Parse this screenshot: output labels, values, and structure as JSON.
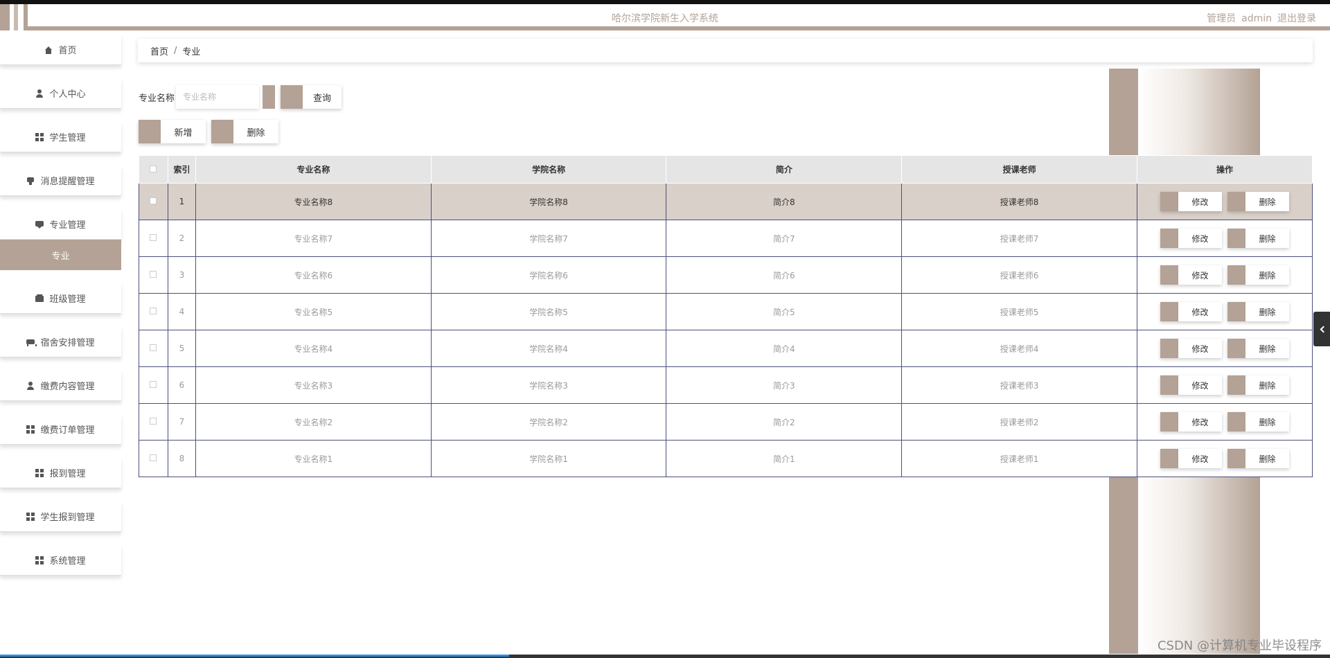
{
  "header": {
    "title": "哈尔滨学院新生入学系统",
    "user_role": "管理员",
    "username": "admin",
    "logout": "退出登录"
  },
  "sidebar": {
    "items": [
      {
        "label": "首页",
        "icon": "home-icon"
      },
      {
        "label": "个人中心",
        "icon": "user-icon"
      },
      {
        "label": "学生管理",
        "icon": "grid-icon"
      },
      {
        "label": "消息提醒管理",
        "icon": "bell-icon"
      },
      {
        "label": "专业管理",
        "icon": "message-icon"
      },
      {
        "label": "班级管理",
        "icon": "wallet-icon"
      },
      {
        "label": "宿舍安排管理",
        "icon": "bed-icon"
      },
      {
        "label": "缴费内容管理",
        "icon": "user-icon"
      },
      {
        "label": "缴费订单管理",
        "icon": "grid-icon"
      },
      {
        "label": "报到管理",
        "icon": "grid-icon"
      },
      {
        "label": "学生报到管理",
        "icon": "grid-icon"
      },
      {
        "label": "系统管理",
        "icon": "grid-icon"
      }
    ],
    "active_sub": "专业"
  },
  "breadcrumb": {
    "home": "首页",
    "sep": "/",
    "current": "专业"
  },
  "search": {
    "label": "专业名称",
    "placeholder": "专业名称",
    "button": "查询"
  },
  "actions": {
    "add": "新增",
    "delete": "删除"
  },
  "table": {
    "headers": [
      "索引",
      "专业名称",
      "学院名称",
      "简介",
      "授课老师",
      "操作"
    ],
    "edit_label": "修改",
    "delete_label": "删除",
    "rows": [
      {
        "index": "1",
        "major": "专业名称8",
        "college": "学院名称8",
        "intro": "简介8",
        "teacher": "授课老师8"
      },
      {
        "index": "2",
        "major": "专业名称7",
        "college": "学院名称7",
        "intro": "简介7",
        "teacher": "授课老师7"
      },
      {
        "index": "3",
        "major": "专业名称6",
        "college": "学院名称6",
        "intro": "简介6",
        "teacher": "授课老师6"
      },
      {
        "index": "4",
        "major": "专业名称5",
        "college": "学院名称5",
        "intro": "简介5",
        "teacher": "授课老师5"
      },
      {
        "index": "5",
        "major": "专业名称4",
        "college": "学院名称4",
        "intro": "简介4",
        "teacher": "授课老师4"
      },
      {
        "index": "6",
        "major": "专业名称3",
        "college": "学院名称3",
        "intro": "简介3",
        "teacher": "授课老师3"
      },
      {
        "index": "7",
        "major": "专业名称2",
        "college": "学院名称2",
        "intro": "简介2",
        "teacher": "授课老师2"
      },
      {
        "index": "8",
        "major": "专业名称1",
        "college": "学院名称1",
        "intro": "简介1",
        "teacher": "授课老师1"
      }
    ]
  },
  "watermark": "CSDN @计算机专业毕设程序",
  "colors": {
    "accent": "#b3a295",
    "row_highlight": "#d9d0c9",
    "header_bg": "#e5e5e5",
    "border": "#4a4f7a"
  }
}
